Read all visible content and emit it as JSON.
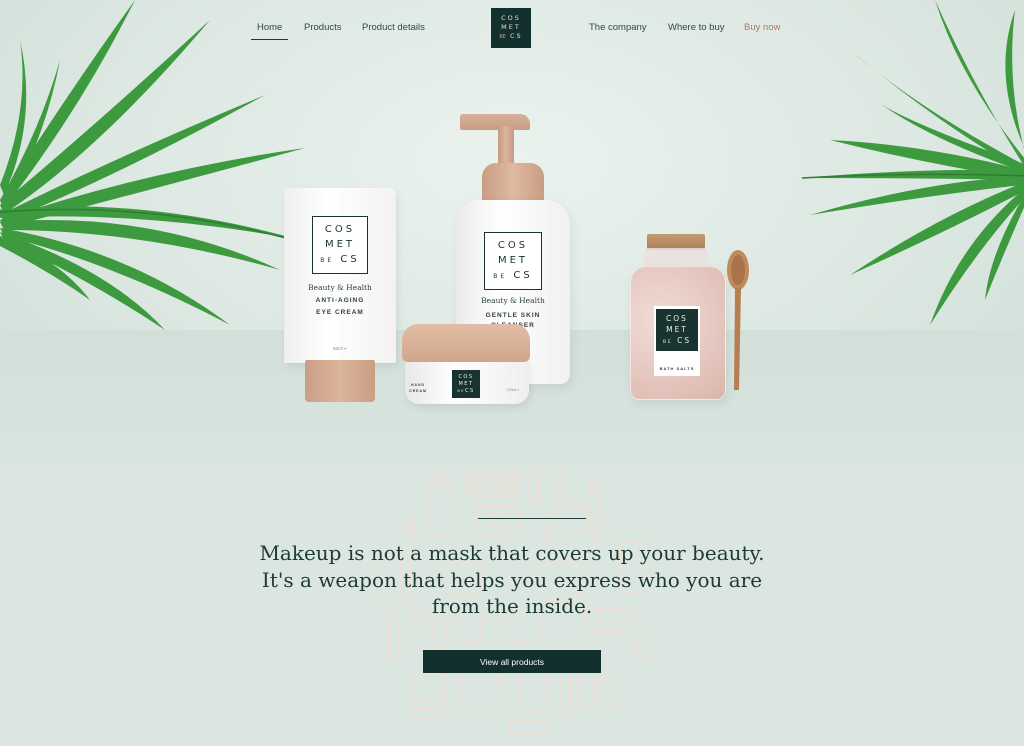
{
  "nav": {
    "home": "Home",
    "products": "Products",
    "product_details": "Product details",
    "company": "The company",
    "where_to_buy": "Where to buy",
    "buy_now": "Buy now"
  },
  "logo": {
    "line1": "COS",
    "line2": "MET",
    "line3_be": "BE",
    "line3_rest": "CS"
  },
  "products": {
    "tube": {
      "tagline": "Beauty & Health",
      "name_line1": "ANTI-AGING",
      "name_line2": "EYE CREAM",
      "volume": "50ml ℮"
    },
    "pump": {
      "tagline": "Beauty & Health",
      "name_line1": "GENTLE SKIN",
      "name_line2": "CLEANSER"
    },
    "jar": {
      "name_line1": "HAND",
      "name_line2": "CREAM",
      "volume": "100ml ℮"
    },
    "salts": {
      "name": "BATH SALTS"
    }
  },
  "quote": {
    "line1": "Makeup is not a mask that covers up your beauty.",
    "line2": "It's a weapon that helps you express who you are",
    "line3": "from the inside."
  },
  "cta": {
    "label": "View all products"
  },
  "colors": {
    "brand_dark": "#12302d",
    "accent": "#b4775c",
    "background": "#dbe6e0",
    "product_tan": "#d7ae94"
  }
}
